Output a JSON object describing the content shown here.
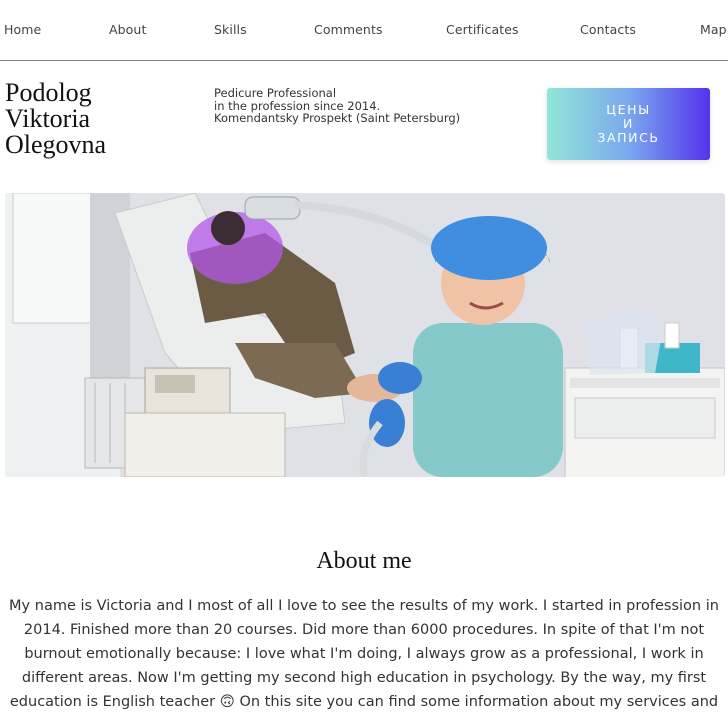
{
  "nav": {
    "items": [
      "Home",
      "About",
      "Skills",
      "Comments",
      "Certificates",
      "Contacts",
      "Map"
    ]
  },
  "header": {
    "name_lines": [
      "Podolog",
      "Viktoria",
      "Olegovna"
    ],
    "tagline_lines": [
      "Pedicure Professional",
      "in the profession since 2014.",
      "Komendantsky Prospekt (Saint Petersburg)"
    ],
    "cta_lines": [
      "ЦЕНЫ",
      "И",
      "ЗАПИСЬ"
    ]
  },
  "hero": {
    "image": "podologist-with-client-photo"
  },
  "about": {
    "title": "About me",
    "lines": [
      "My name is Victoria and I most of all I love to see the results of my work. I started in profession in",
      "2014. Finished more than 20 courses. Did more than 6000 procedures. In spite of that I'm not",
      "burnout emotionally because: I love what I'm doing, I always grow as a professional, I work in",
      "different areas. Now I'm getting my second high education in psychology. By the way, my first",
      "education is English teacher 🙃 On this site you can find some information about my services and"
    ]
  }
}
